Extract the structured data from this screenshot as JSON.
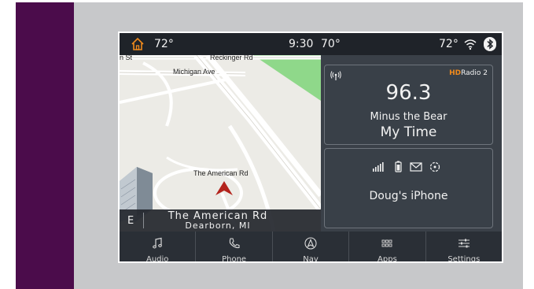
{
  "status_bar": {
    "left_temp": "72°",
    "time": "9:30",
    "mid_temp": "70°",
    "right_temp": "72°"
  },
  "map": {
    "street_labels": [
      "n St",
      "Reckinger Rd",
      "Michigan Ave",
      "The American Rd"
    ],
    "compass": "E",
    "street_name": "The American Rd",
    "city": "Dearborn, MI"
  },
  "radio": {
    "hd_label": "Radio",
    "hd_channel": "2",
    "frequency": "96.3",
    "artist": "Minus the Bear",
    "song": "My Time"
  },
  "phone": {
    "name": "Doug's iPhone"
  },
  "nav": [
    {
      "label": "Audio",
      "icon": "music-note-icon"
    },
    {
      "label": "Phone",
      "icon": "phone-icon"
    },
    {
      "label": "Nav",
      "icon": "navigation-icon"
    },
    {
      "label": "Apps",
      "icon": "apps-grid-icon"
    },
    {
      "label": "Settings",
      "icon": "settings-sliders-icon"
    }
  ],
  "colors": {
    "accent_purple": "#4b0c4b",
    "home_orange": "#f08a1c",
    "hd_orange": "#f08a1c",
    "map_park_green": "#8fd88a",
    "nav_arrow_red": "#b3231c"
  }
}
